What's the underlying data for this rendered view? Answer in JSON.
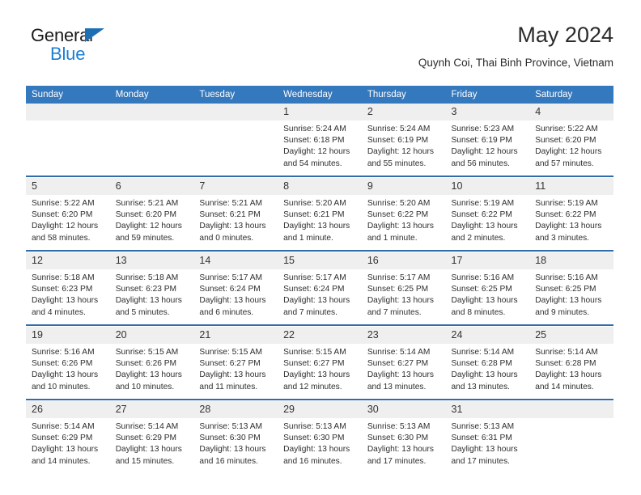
{
  "brand": {
    "name_top": "General",
    "name_bottom": "Blue",
    "accent_color": "#1c7fd4",
    "triangle_color": "#1c6fb5"
  },
  "header": {
    "title": "May 2024",
    "subtitle": "Quynh Coi, Thai Binh Province, Vietnam"
  },
  "theme": {
    "header_row_bg": "#3478bd",
    "week_separator": "#2e6da8",
    "daynum_bg": "#efefef",
    "text": "#2e2e2e"
  },
  "weekday_headers": [
    "Sunday",
    "Monday",
    "Tuesday",
    "Wednesday",
    "Thursday",
    "Friday",
    "Saturday"
  ],
  "labels": {
    "sunrise_prefix": "Sunrise: ",
    "sunset_prefix": "Sunset: ",
    "daylight_prefix": "Daylight: "
  },
  "weeks": [
    [
      {
        "day": ""
      },
      {
        "day": ""
      },
      {
        "day": ""
      },
      {
        "day": "1",
        "line1": "Sunrise: 5:24 AM",
        "line2": "Sunset: 6:18 PM",
        "line3": "Daylight: 12 hours and 54 minutes."
      },
      {
        "day": "2",
        "line1": "Sunrise: 5:24 AM",
        "line2": "Sunset: 6:19 PM",
        "line3": "Daylight: 12 hours and 55 minutes."
      },
      {
        "day": "3",
        "line1": "Sunrise: 5:23 AM",
        "line2": "Sunset: 6:19 PM",
        "line3": "Daylight: 12 hours and 56 minutes."
      },
      {
        "day": "4",
        "line1": "Sunrise: 5:22 AM",
        "line2": "Sunset: 6:20 PM",
        "line3": "Daylight: 12 hours and 57 minutes."
      }
    ],
    [
      {
        "day": "5",
        "line1": "Sunrise: 5:22 AM",
        "line2": "Sunset: 6:20 PM",
        "line3": "Daylight: 12 hours and 58 minutes."
      },
      {
        "day": "6",
        "line1": "Sunrise: 5:21 AM",
        "line2": "Sunset: 6:20 PM",
        "line3": "Daylight: 12 hours and 59 minutes."
      },
      {
        "day": "7",
        "line1": "Sunrise: 5:21 AM",
        "line2": "Sunset: 6:21 PM",
        "line3": "Daylight: 13 hours and 0 minutes."
      },
      {
        "day": "8",
        "line1": "Sunrise: 5:20 AM",
        "line2": "Sunset: 6:21 PM",
        "line3": "Daylight: 13 hours and 1 minute."
      },
      {
        "day": "9",
        "line1": "Sunrise: 5:20 AM",
        "line2": "Sunset: 6:22 PM",
        "line3": "Daylight: 13 hours and 1 minute."
      },
      {
        "day": "10",
        "line1": "Sunrise: 5:19 AM",
        "line2": "Sunset: 6:22 PM",
        "line3": "Daylight: 13 hours and 2 minutes."
      },
      {
        "day": "11",
        "line1": "Sunrise: 5:19 AM",
        "line2": "Sunset: 6:22 PM",
        "line3": "Daylight: 13 hours and 3 minutes."
      }
    ],
    [
      {
        "day": "12",
        "line1": "Sunrise: 5:18 AM",
        "line2": "Sunset: 6:23 PM",
        "line3": "Daylight: 13 hours and 4 minutes."
      },
      {
        "day": "13",
        "line1": "Sunrise: 5:18 AM",
        "line2": "Sunset: 6:23 PM",
        "line3": "Daylight: 13 hours and 5 minutes."
      },
      {
        "day": "14",
        "line1": "Sunrise: 5:17 AM",
        "line2": "Sunset: 6:24 PM",
        "line3": "Daylight: 13 hours and 6 minutes."
      },
      {
        "day": "15",
        "line1": "Sunrise: 5:17 AM",
        "line2": "Sunset: 6:24 PM",
        "line3": "Daylight: 13 hours and 7 minutes."
      },
      {
        "day": "16",
        "line1": "Sunrise: 5:17 AM",
        "line2": "Sunset: 6:25 PM",
        "line3": "Daylight: 13 hours and 7 minutes."
      },
      {
        "day": "17",
        "line1": "Sunrise: 5:16 AM",
        "line2": "Sunset: 6:25 PM",
        "line3": "Daylight: 13 hours and 8 minutes."
      },
      {
        "day": "18",
        "line1": "Sunrise: 5:16 AM",
        "line2": "Sunset: 6:25 PM",
        "line3": "Daylight: 13 hours and 9 minutes."
      }
    ],
    [
      {
        "day": "19",
        "line1": "Sunrise: 5:16 AM",
        "line2": "Sunset: 6:26 PM",
        "line3": "Daylight: 13 hours and 10 minutes."
      },
      {
        "day": "20",
        "line1": "Sunrise: 5:15 AM",
        "line2": "Sunset: 6:26 PM",
        "line3": "Daylight: 13 hours and 10 minutes."
      },
      {
        "day": "21",
        "line1": "Sunrise: 5:15 AM",
        "line2": "Sunset: 6:27 PM",
        "line3": "Daylight: 13 hours and 11 minutes."
      },
      {
        "day": "22",
        "line1": "Sunrise: 5:15 AM",
        "line2": "Sunset: 6:27 PM",
        "line3": "Daylight: 13 hours and 12 minutes."
      },
      {
        "day": "23",
        "line1": "Sunrise: 5:14 AM",
        "line2": "Sunset: 6:27 PM",
        "line3": "Daylight: 13 hours and 13 minutes."
      },
      {
        "day": "24",
        "line1": "Sunrise: 5:14 AM",
        "line2": "Sunset: 6:28 PM",
        "line3": "Daylight: 13 hours and 13 minutes."
      },
      {
        "day": "25",
        "line1": "Sunrise: 5:14 AM",
        "line2": "Sunset: 6:28 PM",
        "line3": "Daylight: 13 hours and 14 minutes."
      }
    ],
    [
      {
        "day": "26",
        "line1": "Sunrise: 5:14 AM",
        "line2": "Sunset: 6:29 PM",
        "line3": "Daylight: 13 hours and 14 minutes."
      },
      {
        "day": "27",
        "line1": "Sunrise: 5:14 AM",
        "line2": "Sunset: 6:29 PM",
        "line3": "Daylight: 13 hours and 15 minutes."
      },
      {
        "day": "28",
        "line1": "Sunrise: 5:13 AM",
        "line2": "Sunset: 6:30 PM",
        "line3": "Daylight: 13 hours and 16 minutes."
      },
      {
        "day": "29",
        "line1": "Sunrise: 5:13 AM",
        "line2": "Sunset: 6:30 PM",
        "line3": "Daylight: 13 hours and 16 minutes."
      },
      {
        "day": "30",
        "line1": "Sunrise: 5:13 AM",
        "line2": "Sunset: 6:30 PM",
        "line3": "Daylight: 13 hours and 17 minutes."
      },
      {
        "day": "31",
        "line1": "Sunrise: 5:13 AM",
        "line2": "Sunset: 6:31 PM",
        "line3": "Daylight: 13 hours and 17 minutes."
      },
      {
        "day": ""
      }
    ]
  ]
}
